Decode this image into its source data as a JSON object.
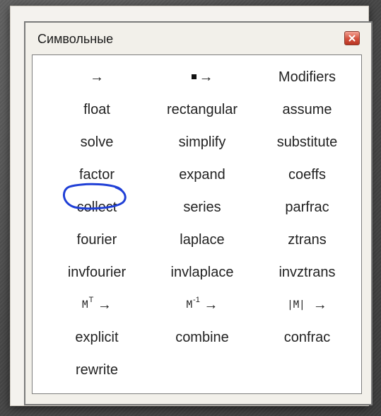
{
  "window": {
    "title": "Символьные",
    "close_icon": "close-icon"
  },
  "palette": {
    "items": [
      [
        "→",
        "▪ →",
        "Modifiers"
      ],
      [
        "float",
        "rectangular",
        "assume"
      ],
      [
        "solve",
        "simplify",
        "substitute"
      ],
      [
        "factor",
        "expand",
        "coeffs"
      ],
      [
        "collect",
        "series",
        "parfrac"
      ],
      [
        "fourier",
        "laplace",
        "ztrans"
      ],
      [
        "invfourier",
        "invlaplace",
        "invztrans"
      ],
      [
        "Mᵀ →",
        "M⁻¹ →",
        "|M| →"
      ],
      [
        "explicit",
        "combine",
        "confrac"
      ],
      [
        "rewrite"
      ]
    ],
    "matrix_ops": {
      "transpose": {
        "base": "M",
        "sup": "T",
        "arrow": "→"
      },
      "inverse": {
        "base": "M",
        "sup": "-1",
        "arrow": "→"
      },
      "determinant": {
        "base": "|M|",
        "arrow": "→"
      }
    },
    "highlighted_item": "solve",
    "highlight_color": "#1f3fd6"
  }
}
